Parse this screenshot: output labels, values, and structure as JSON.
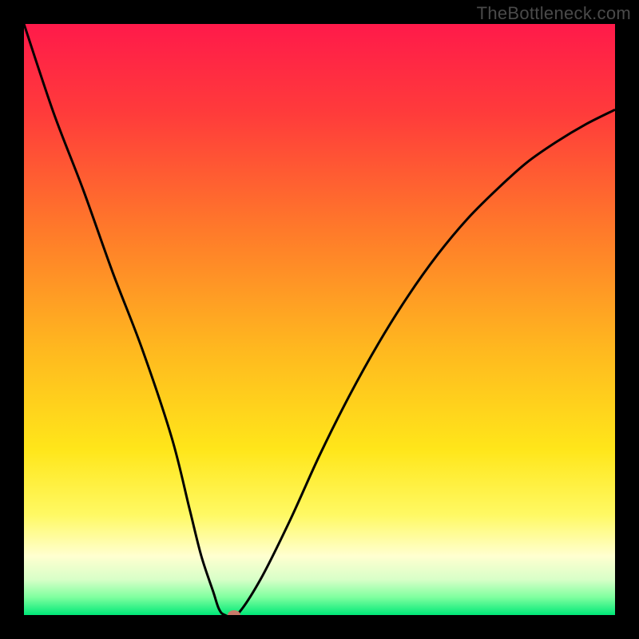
{
  "watermark": "TheBottleneck.com",
  "chart_data": {
    "type": "line",
    "title": "",
    "xlabel": "",
    "ylabel": "",
    "xlim": [
      0,
      100
    ],
    "ylim": [
      0,
      100
    ],
    "background": {
      "type": "vertical-gradient",
      "stops": [
        {
          "pos": 0,
          "color": "#ff1a4a"
        },
        {
          "pos": 15,
          "color": "#ff3b3b"
        },
        {
          "pos": 35,
          "color": "#ff7a2a"
        },
        {
          "pos": 55,
          "color": "#ffb81f"
        },
        {
          "pos": 72,
          "color": "#ffe61a"
        },
        {
          "pos": 83,
          "color": "#fff963"
        },
        {
          "pos": 90,
          "color": "#ffffd0"
        },
        {
          "pos": 94,
          "color": "#d8ffc8"
        },
        {
          "pos": 97,
          "color": "#7fff9f"
        },
        {
          "pos": 100,
          "color": "#00e878"
        }
      ]
    },
    "series": [
      {
        "name": "bottleneck-curve",
        "x": [
          0,
          5,
          10,
          15,
          20,
          25,
          28,
          30,
          32,
          33,
          34,
          36,
          40,
          45,
          50,
          55,
          60,
          65,
          70,
          75,
          80,
          85,
          90,
          95,
          100
        ],
        "values": [
          100,
          85,
          72,
          58,
          45,
          30,
          18,
          10,
          4,
          1,
          0,
          0,
          6,
          16,
          27,
          37,
          46,
          54,
          61,
          67,
          72,
          76.5,
          80,
          83,
          85.5
        ]
      }
    ],
    "marker": {
      "x": 35.5,
      "y": 0,
      "color": "#c97a6a"
    }
  }
}
